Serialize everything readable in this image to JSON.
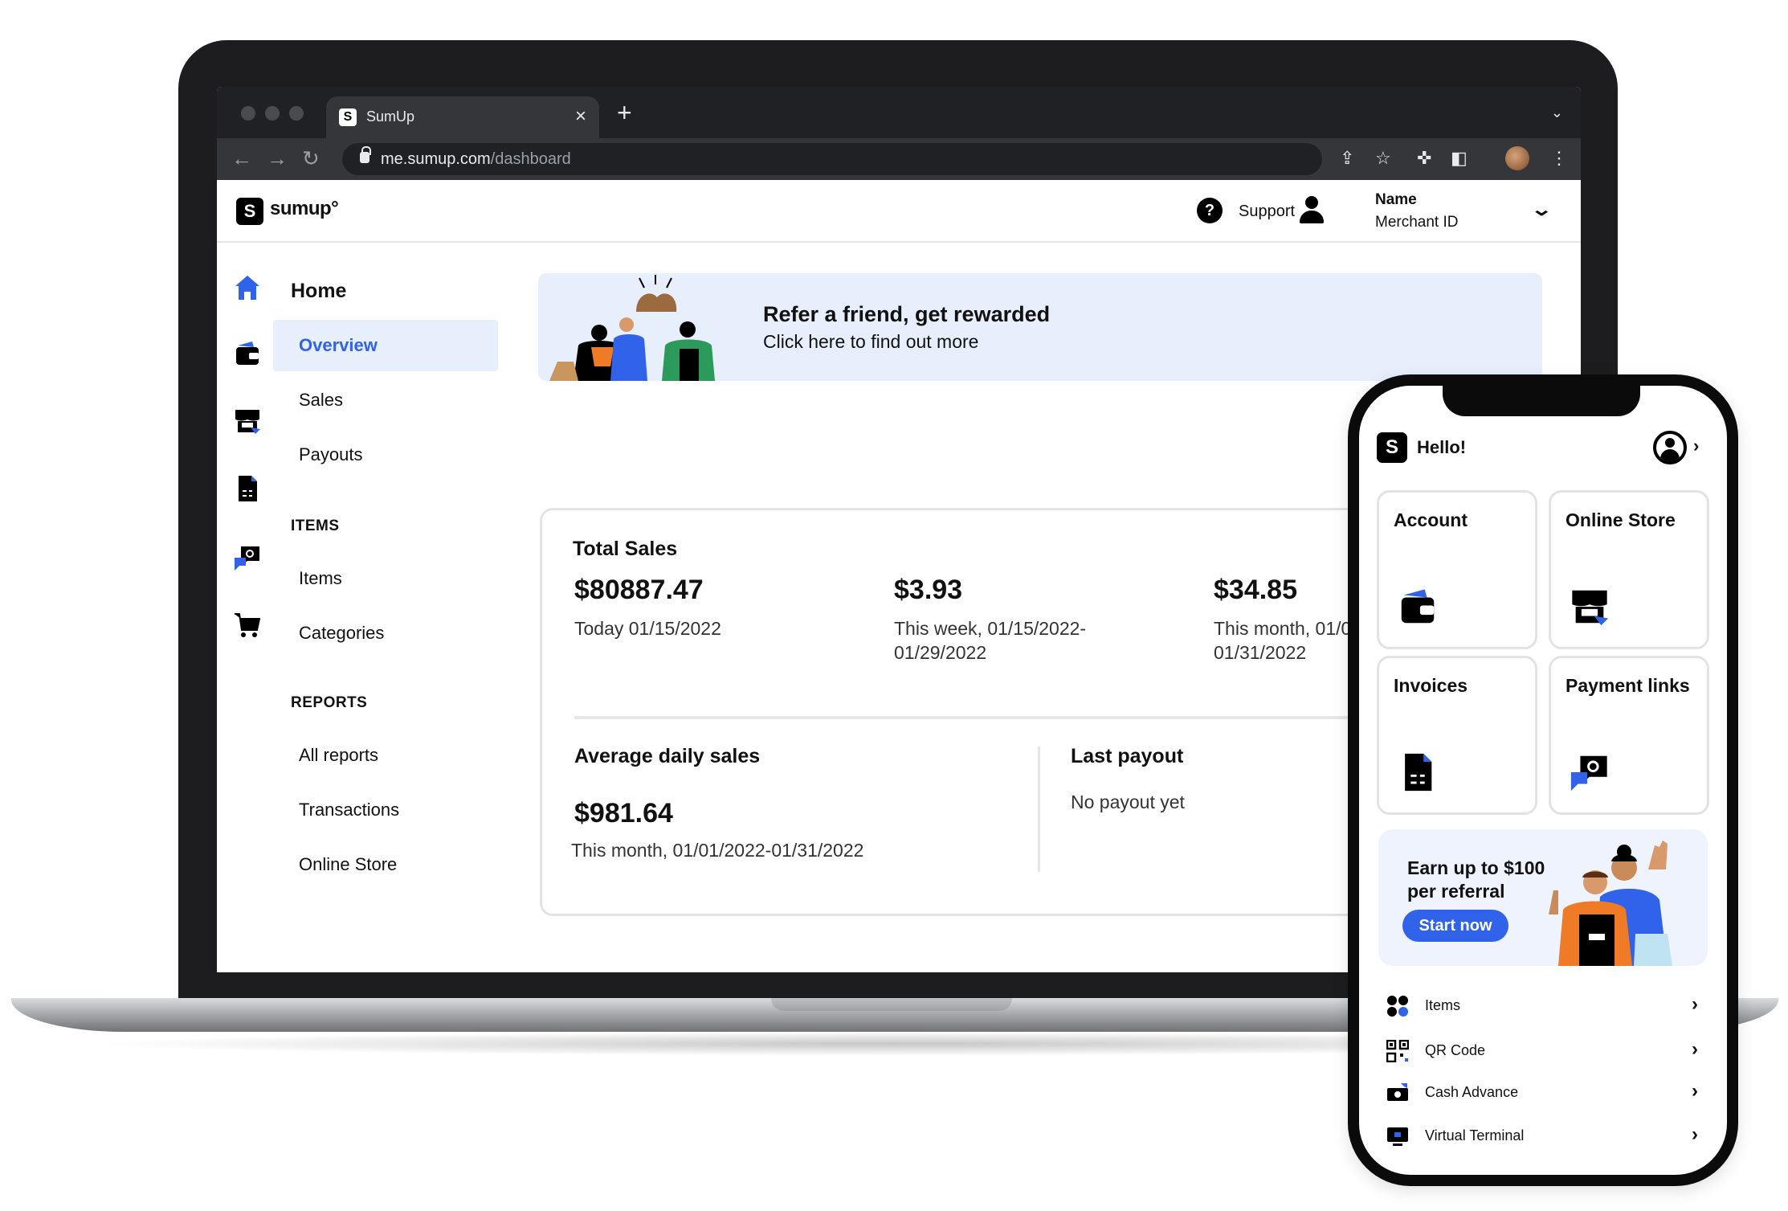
{
  "browser": {
    "tab_title": "SumUp",
    "tab_close": "×",
    "new_tab": "+",
    "tab_menu": "⌄",
    "url_host": "me.sumup.com",
    "url_path": "/dashboard"
  },
  "header": {
    "brand": "sumup°",
    "support_label": "Support",
    "user_name": "Name",
    "merchant_id": "Merchant ID"
  },
  "sidebar": {
    "home_title": "Home",
    "items": [
      {
        "label": "Overview",
        "active": true
      },
      {
        "label": "Sales"
      },
      {
        "label": "Payouts"
      }
    ],
    "items_section": "ITEMS",
    "items_links": [
      {
        "label": "Items"
      },
      {
        "label": "Categories"
      }
    ],
    "reports_section": "REPORTS",
    "reports_links": [
      {
        "label": "All reports"
      },
      {
        "label": "Transactions"
      },
      {
        "label": "Online Store"
      }
    ]
  },
  "banner": {
    "title": "Refer a friend, get rewarded",
    "subtitle": "Click here to find out more"
  },
  "total_sales": {
    "title": "Total Sales",
    "metrics": [
      {
        "value": "$80887.47",
        "label": "Today 01/15/2022"
      },
      {
        "value": "$3.93",
        "label": "This week, 01/15/2022-01/29/2022"
      },
      {
        "value": "$34.85",
        "label": "This month, 01/01/2022-01/31/2022"
      }
    ],
    "avg_title": "Average daily sales",
    "avg_value": "$981.64",
    "avg_label": "This month, 01/01/2022-01/31/2022",
    "payout_title": "Last payout",
    "payout_label": "No payout yet"
  },
  "phone": {
    "greeting": "Hello!",
    "tiles": [
      {
        "label": "Account"
      },
      {
        "label": "Online Store"
      },
      {
        "label": "Invoices"
      },
      {
        "label": "Payment links"
      }
    ],
    "promo_title": "Earn up to $100 per referral",
    "promo_button": "Start now",
    "rows": [
      {
        "label": "Items"
      },
      {
        "label": "QR Code"
      },
      {
        "label": "Cash Advance"
      },
      {
        "label": "Virtual Terminal"
      }
    ]
  },
  "colors": {
    "accent": "#3063e9",
    "active_bg": "#e7eefc",
    "browser_dark": "#202124",
    "device_frame": "#1d1d1f"
  }
}
